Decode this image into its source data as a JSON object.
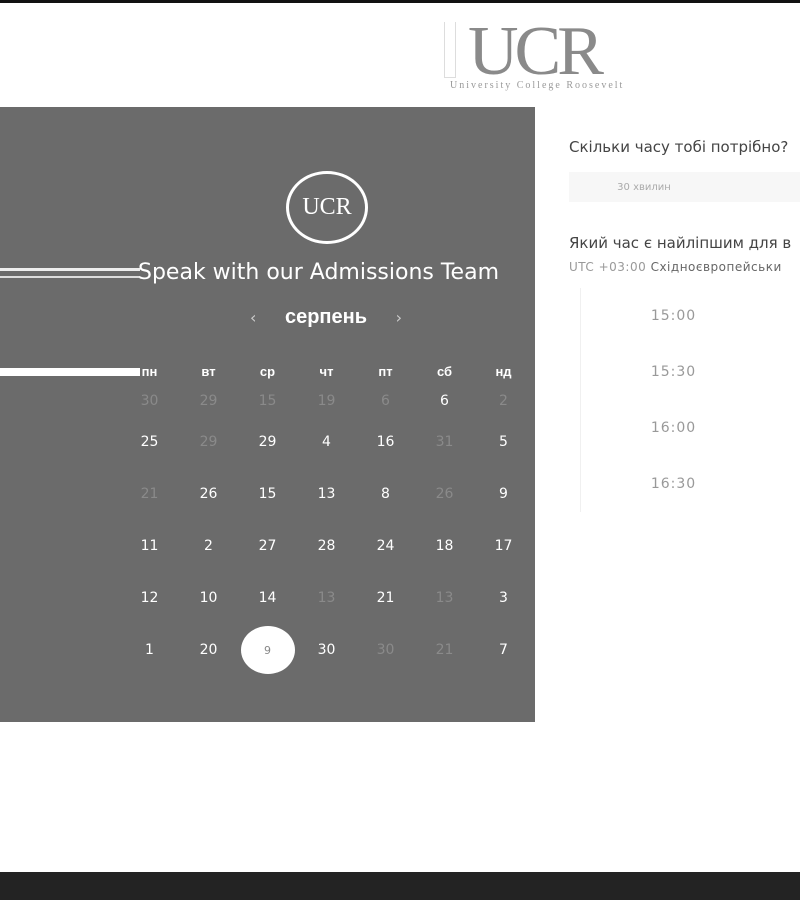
{
  "header": {
    "logo_text": "UCR",
    "logo_subtitle": "University College Roosevelt"
  },
  "calendar": {
    "badge_text": "UCR",
    "title": "Speak with our Admissions Team",
    "month": "серпень",
    "prev": "‹",
    "next": "›",
    "weekdays": [
      "пн",
      "вт",
      "ср",
      "чт",
      "пт",
      "сб",
      "нд"
    ],
    "weeks": [
      [
        [
          "30",
          0
        ],
        [
          "29",
          0
        ],
        [
          "15",
          0
        ],
        [
          "19",
          0
        ],
        [
          "6",
          0
        ],
        [
          "6",
          1
        ],
        [
          "2",
          0
        ]
      ],
      [
        [
          "25",
          1
        ],
        [
          "29",
          0
        ],
        [
          "29",
          1
        ],
        [
          "4",
          1
        ],
        [
          "16",
          1
        ],
        [
          "31",
          0
        ],
        [
          "5",
          1
        ]
      ],
      [
        [
          "21",
          0
        ],
        [
          "26",
          1
        ],
        [
          "15",
          1
        ],
        [
          "13",
          1
        ],
        [
          "8",
          1
        ],
        [
          "26",
          0
        ],
        [
          "9",
          1
        ]
      ],
      [
        [
          "11",
          1
        ],
        [
          "2",
          1
        ],
        [
          "27",
          1
        ],
        [
          "28",
          1
        ],
        [
          "24",
          1
        ],
        [
          "18",
          1
        ],
        [
          "17",
          1
        ]
      ],
      [
        [
          "12",
          1
        ],
        [
          "10",
          1
        ],
        [
          "14",
          1
        ],
        [
          "13",
          0
        ],
        [
          "21",
          1
        ],
        [
          "13",
          0
        ],
        [
          "3",
          1
        ]
      ],
      [
        [
          "1",
          1
        ],
        [
          "20",
          1
        ],
        [
          "9",
          2
        ],
        [
          "30",
          1
        ],
        [
          "30",
          0
        ],
        [
          "21",
          0
        ],
        [
          "7",
          1
        ]
      ]
    ]
  },
  "booking": {
    "duration_question": "Скільки часу тобі потрібно?",
    "duration_value": "30 хвилин",
    "time_question": "Який час є найліпшим для в",
    "tz_offset": "UTC +03:00",
    "tz_name": "Східноєвропейськи",
    "slots": [
      "15:00",
      "15:30",
      "16:00",
      "16:30"
    ]
  }
}
